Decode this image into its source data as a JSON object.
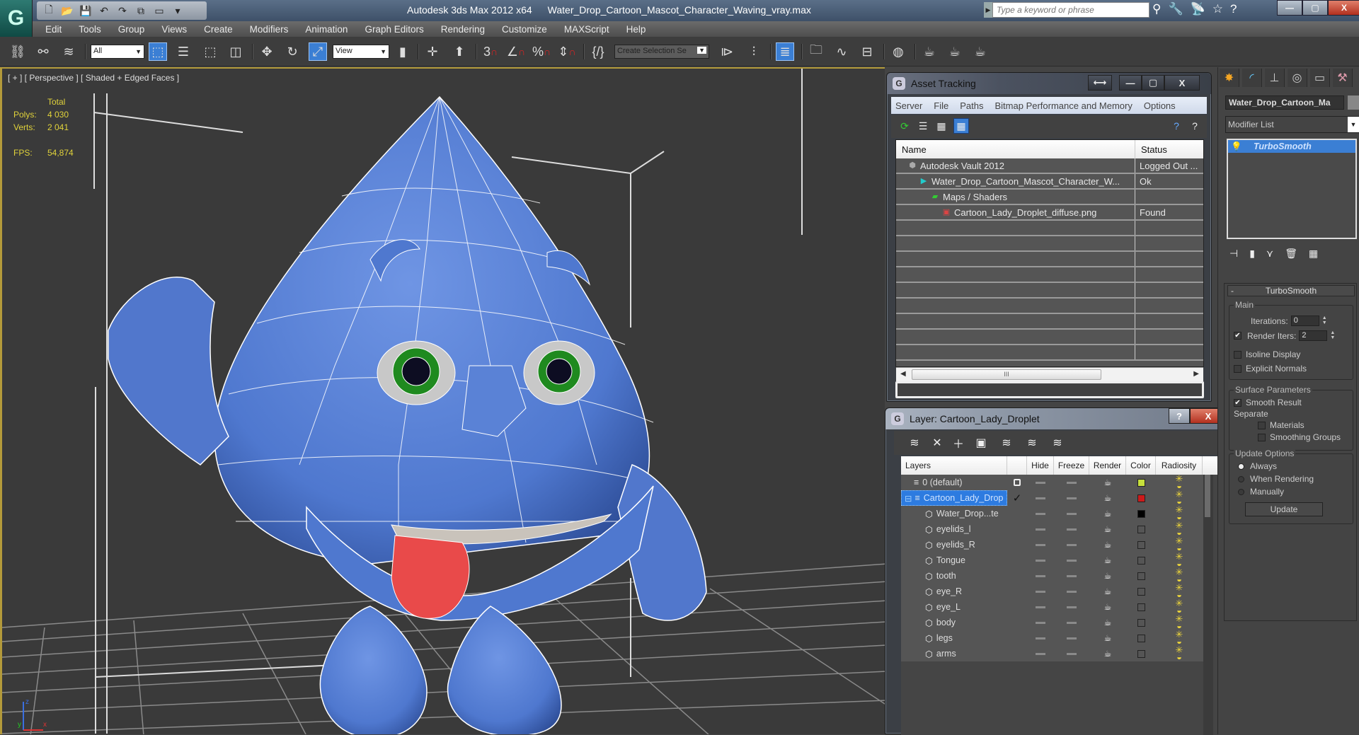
{
  "titlebar": {
    "app_name": "Autodesk 3ds Max  2012 x64",
    "file_name": "Water_Drop_Cartoon_Mascot_Character_Waving_vray.max",
    "search_placeholder": "Type a keyword or phrase",
    "logo_glyph": "G",
    "quick_access": [
      "new-file-icon",
      "open-file-icon",
      "save-icon",
      "undo-icon",
      "redo-icon",
      "project-folder-icon",
      "window-icon",
      "dropdown-icon"
    ],
    "tools": [
      "binoculars-icon",
      "key-icon",
      "satellite-icon",
      "star-icon",
      "help-icon"
    ],
    "window_controls": {
      "minimize": "—",
      "restore": "▢",
      "close": "X"
    }
  },
  "menubar": {
    "items": [
      "Edit",
      "Tools",
      "Group",
      "Views",
      "Create",
      "Modifiers",
      "Animation",
      "Graph Editors",
      "Rendering",
      "Customize",
      "MAXScript",
      "Help"
    ]
  },
  "toolbar": {
    "selection_filter": "All",
    "reference_coord": "View",
    "named_selection": "Create Selection Se",
    "snap_labels": {
      "snaps": "3",
      "angle": "∠",
      "percent": "%",
      "spinner": "⇕"
    }
  },
  "viewport": {
    "label": "[ + ] [ Perspective ] [ Shaded + Edged Faces ]",
    "stats": {
      "header": "Total",
      "polys_label": "Polys:",
      "polys_value": "4 030",
      "verts_label": "Verts:",
      "verts_value": "2 041",
      "fps_label": "FPS:",
      "fps_value": "54,874"
    },
    "axis": {
      "x": "x",
      "y": "y",
      "z": "z"
    },
    "colors": {
      "body": "#5a82d6",
      "tongue": "#e94a4a",
      "iris": "#1f8a1f",
      "wire": "#ffffff",
      "bg": "#3a3a3a",
      "border": "#b39a3a"
    }
  },
  "asset_tracking": {
    "title": "Asset Tracking",
    "menu": [
      "Server",
      "File",
      "Paths",
      "Bitmap Performance and Memory",
      "Options"
    ],
    "columns": [
      "Name",
      "Status"
    ],
    "rows": [
      {
        "name": "Autodesk Vault 2012",
        "status": "Logged Out ...",
        "icon": "vault-icon",
        "indent": 1
      },
      {
        "name": "Water_Drop_Cartoon_Mascot_Character_W...",
        "status": "Ok",
        "icon": "max-file-icon",
        "indent": 2
      },
      {
        "name": "Maps / Shaders",
        "status": "",
        "icon": "maps-icon",
        "indent": 3
      },
      {
        "name": "Cartoon_Lady_Droplet_diffuse.png",
        "status": "Found",
        "icon": "image-file-icon",
        "indent": 4
      }
    ],
    "empty_rows": 9,
    "scroll_grip": "III"
  },
  "layer_manager": {
    "title": "Layer: Cartoon_Lady_Droplet",
    "columns": [
      "Layers",
      "",
      "Hide",
      "Freeze",
      "Render",
      "Color",
      "Radiosity"
    ],
    "rows": [
      {
        "name": "0 (default)",
        "type": "layer",
        "active": "box",
        "color": "#c7e03c",
        "selected": false
      },
      {
        "name": "Cartoon_Lady_Drop",
        "type": "layer",
        "active": "check",
        "color": "#cc1a1a",
        "selected": true,
        "expander": "⊟"
      },
      {
        "name": "Water_Drop...te",
        "type": "object",
        "active": "",
        "color": "#000000",
        "selected": false
      },
      {
        "name": "eyelids_l",
        "type": "object",
        "active": "",
        "color": "",
        "selected": false
      },
      {
        "name": "eyelids_R",
        "type": "object",
        "active": "",
        "color": "",
        "selected": false
      },
      {
        "name": "Tongue",
        "type": "object",
        "active": "",
        "color": "",
        "selected": false
      },
      {
        "name": "tooth",
        "type": "object",
        "active": "",
        "color": "",
        "selected": false
      },
      {
        "name": "eye_R",
        "type": "object",
        "active": "",
        "color": "",
        "selected": false
      },
      {
        "name": "eye_L",
        "type": "object",
        "active": "",
        "color": "",
        "selected": false
      },
      {
        "name": "body",
        "type": "object",
        "active": "",
        "color": "",
        "selected": false
      },
      {
        "name": "legs",
        "type": "object",
        "active": "",
        "color": "",
        "selected": false
      },
      {
        "name": "arms",
        "type": "object",
        "active": "",
        "color": "",
        "selected": false
      }
    ],
    "toolbar": [
      "new-layer-icon",
      "delete-icon",
      "add-to-layer-icon",
      "select-objects-icon",
      "select-layer-icon",
      "highlight-layer-icon",
      "hide-freeze-icon"
    ],
    "help_btn": "?",
    "close_btn": "X"
  },
  "command_panel": {
    "tabs": [
      "create-icon",
      "modify-icon",
      "hierarchy-icon",
      "motion-icon",
      "display-icon",
      "utilities-icon"
    ],
    "object_name": "Water_Drop_Cartoon_Ma",
    "modifier_list": "Modifier List",
    "stack": [
      "TurboSmooth"
    ],
    "rollout_title": "TurboSmooth",
    "rollout_minus": "-",
    "main": {
      "label": "Main",
      "iterations_label": "Iterations:",
      "iterations_value": "0",
      "render_iters_label": "Render Iters:",
      "render_iters_value": "2",
      "render_iters_checked": true,
      "isoline_label": "Isoline Display",
      "isoline_checked": false,
      "explicit_label": "Explicit Normals",
      "explicit_checked": false
    },
    "surface": {
      "label": "Surface Parameters",
      "smooth_result_label": "Smooth Result",
      "smooth_result_checked": true,
      "separate_label": "Separate",
      "materials_label": "Materials",
      "materials_checked": false,
      "smoothing_groups_label": "Smoothing Groups",
      "smoothing_groups_checked": false
    },
    "update": {
      "label": "Update Options",
      "always": "Always",
      "when_rendering": "When Rendering",
      "manually": "Manually",
      "selected": "Always",
      "button": "Update"
    }
  }
}
